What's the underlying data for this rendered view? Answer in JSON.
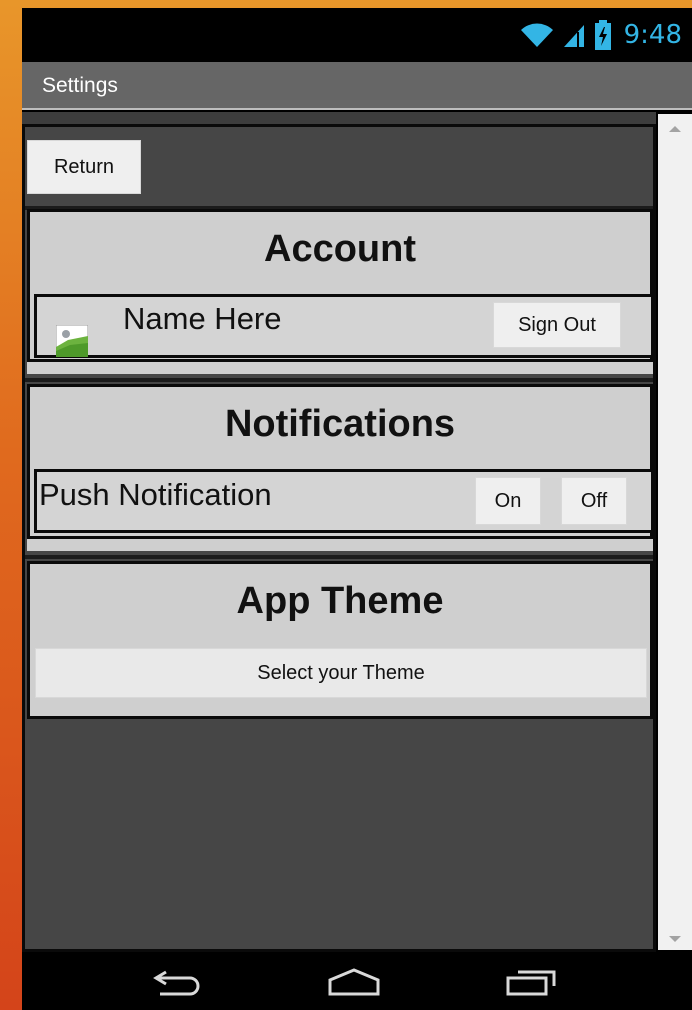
{
  "status_bar": {
    "time": "9:48",
    "icons": [
      "wifi-icon",
      "cell-signal-icon",
      "battery-charging-icon"
    ],
    "icon_color": "#33b5e5"
  },
  "title_bar": {
    "title": "Settings"
  },
  "return_button": {
    "label": "Return"
  },
  "account": {
    "header": "Account",
    "name": "Name Here",
    "avatar_icon": "image-placeholder-icon",
    "sign_out_label": "Sign Out"
  },
  "notifications": {
    "header": "Notifications",
    "push_label": "Push Notification",
    "on_label": "On",
    "off_label": "Off"
  },
  "app_theme": {
    "header": "App Theme",
    "select_label": "Select your Theme"
  },
  "nav_bar": {
    "icons": [
      "back-icon",
      "home-icon",
      "recent-apps-icon"
    ]
  }
}
